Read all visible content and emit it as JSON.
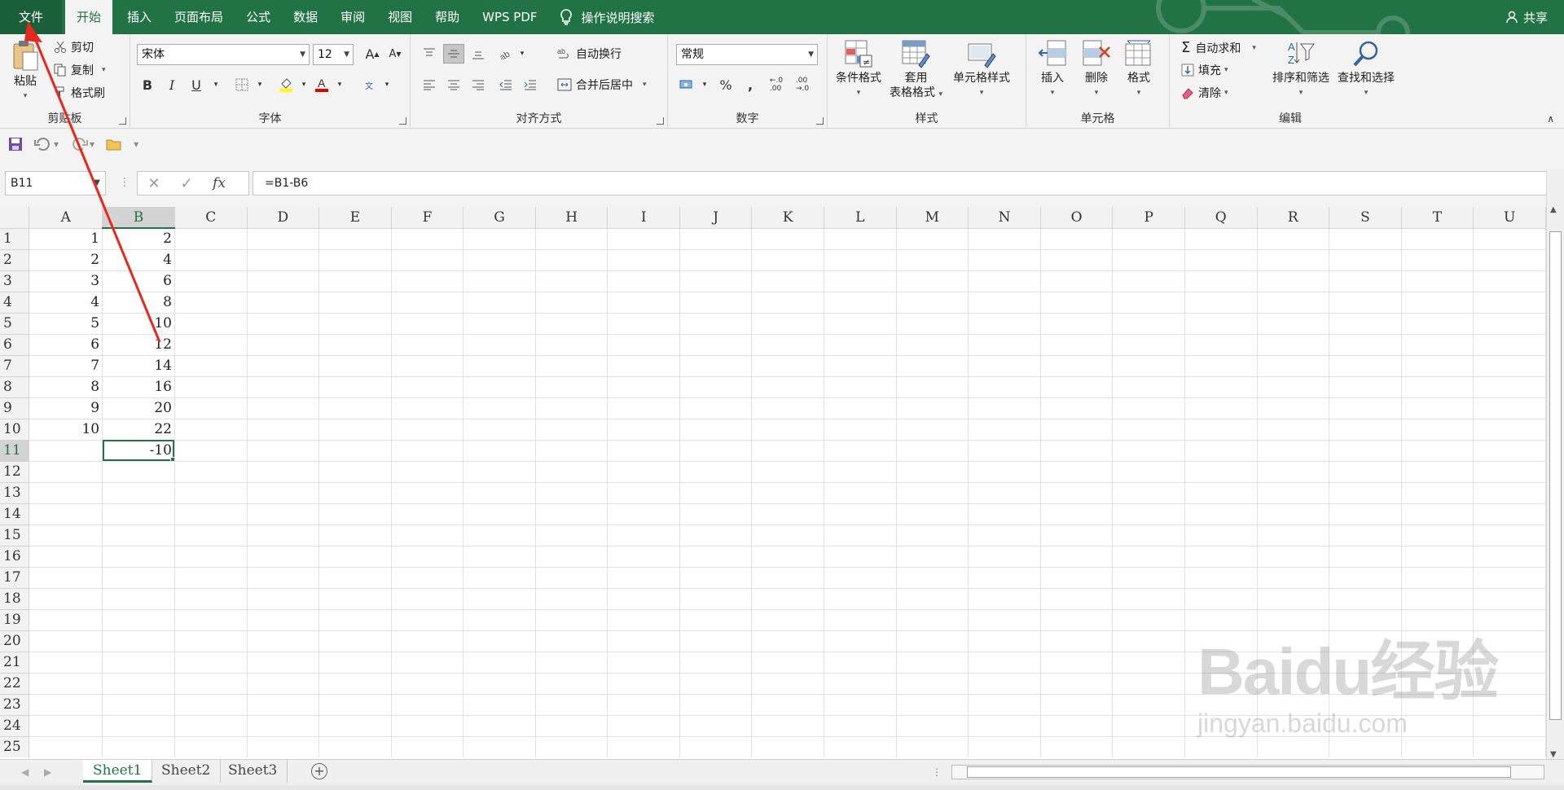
{
  "ribbon_tabs": [
    "文件",
    "开始",
    "插入",
    "页面布局",
    "公式",
    "数据",
    "审阅",
    "视图",
    "帮助",
    "WPS PDF"
  ],
  "active_tab": "开始",
  "tell_me": "操作说明搜索",
  "share": "共享",
  "clipboard": {
    "paste": "粘贴",
    "cut": "剪切",
    "copy": "复制",
    "format_painter": "格式刷",
    "label": "剪贴板"
  },
  "font": {
    "name": "宋体",
    "size": "12",
    "bold": "B",
    "italic": "I",
    "underline": "U",
    "label": "字体"
  },
  "alignment": {
    "wrap_text": "自动换行",
    "merge_center": "合并后居中",
    "label": "对齐方式"
  },
  "number": {
    "format": "常规",
    "label": "数字"
  },
  "styles": {
    "conditional": "条件格式",
    "table_format_1": "套用",
    "table_format_2": "表格格式",
    "cell_styles": "单元格样式",
    "label": "样式"
  },
  "cells": {
    "insert": "插入",
    "delete": "删除",
    "format": "格式",
    "label": "单元格"
  },
  "editing": {
    "autosum": "自动求和",
    "fill": "填充",
    "clear": "清除",
    "sort_filter": "排序和筛选",
    "find_select": "查找和选择",
    "label": "编辑"
  },
  "formula_bar": {
    "name_box": "B11",
    "fx": "fx",
    "formula": "=B1-B6"
  },
  "columns": [
    "A",
    "B",
    "C",
    "D",
    "E",
    "F",
    "G",
    "H",
    "I",
    "J",
    "K",
    "L",
    "M",
    "N",
    "O",
    "P",
    "Q",
    "R",
    "S",
    "T",
    "U"
  ],
  "rows": [
    {
      "n": "1",
      "A": "1",
      "B": "2"
    },
    {
      "n": "2",
      "A": "2",
      "B": "4"
    },
    {
      "n": "3",
      "A": "3",
      "B": "6"
    },
    {
      "n": "4",
      "A": "4",
      "B": "8"
    },
    {
      "n": "5",
      "A": "5",
      "B": "10"
    },
    {
      "n": "6",
      "A": "6",
      "B": "12"
    },
    {
      "n": "7",
      "A": "7",
      "B": "14"
    },
    {
      "n": "8",
      "A": "8",
      "B": "16"
    },
    {
      "n": "9",
      "A": "9",
      "B": "20"
    },
    {
      "n": "10",
      "A": "10",
      "B": "22"
    },
    {
      "n": "11",
      "A": "",
      "B": "-10"
    },
    {
      "n": "12"
    },
    {
      "n": "13"
    },
    {
      "n": "14"
    },
    {
      "n": "15"
    },
    {
      "n": "16"
    },
    {
      "n": "17"
    },
    {
      "n": "18"
    },
    {
      "n": "19"
    },
    {
      "n": "20"
    },
    {
      "n": "21"
    },
    {
      "n": "22"
    },
    {
      "n": "23"
    },
    {
      "n": "24"
    },
    {
      "n": "25"
    }
  ],
  "active_cell": {
    "row": "11",
    "col": "B"
  },
  "sheet_tabs": [
    "Sheet1",
    "Sheet2",
    "Sheet3"
  ],
  "active_sheet": "Sheet1",
  "watermark": {
    "logo": "Baidu经验",
    "url": "jingyan.baidu.com"
  },
  "colors": {
    "accent": "#217346",
    "arrow": "#e8281e"
  }
}
